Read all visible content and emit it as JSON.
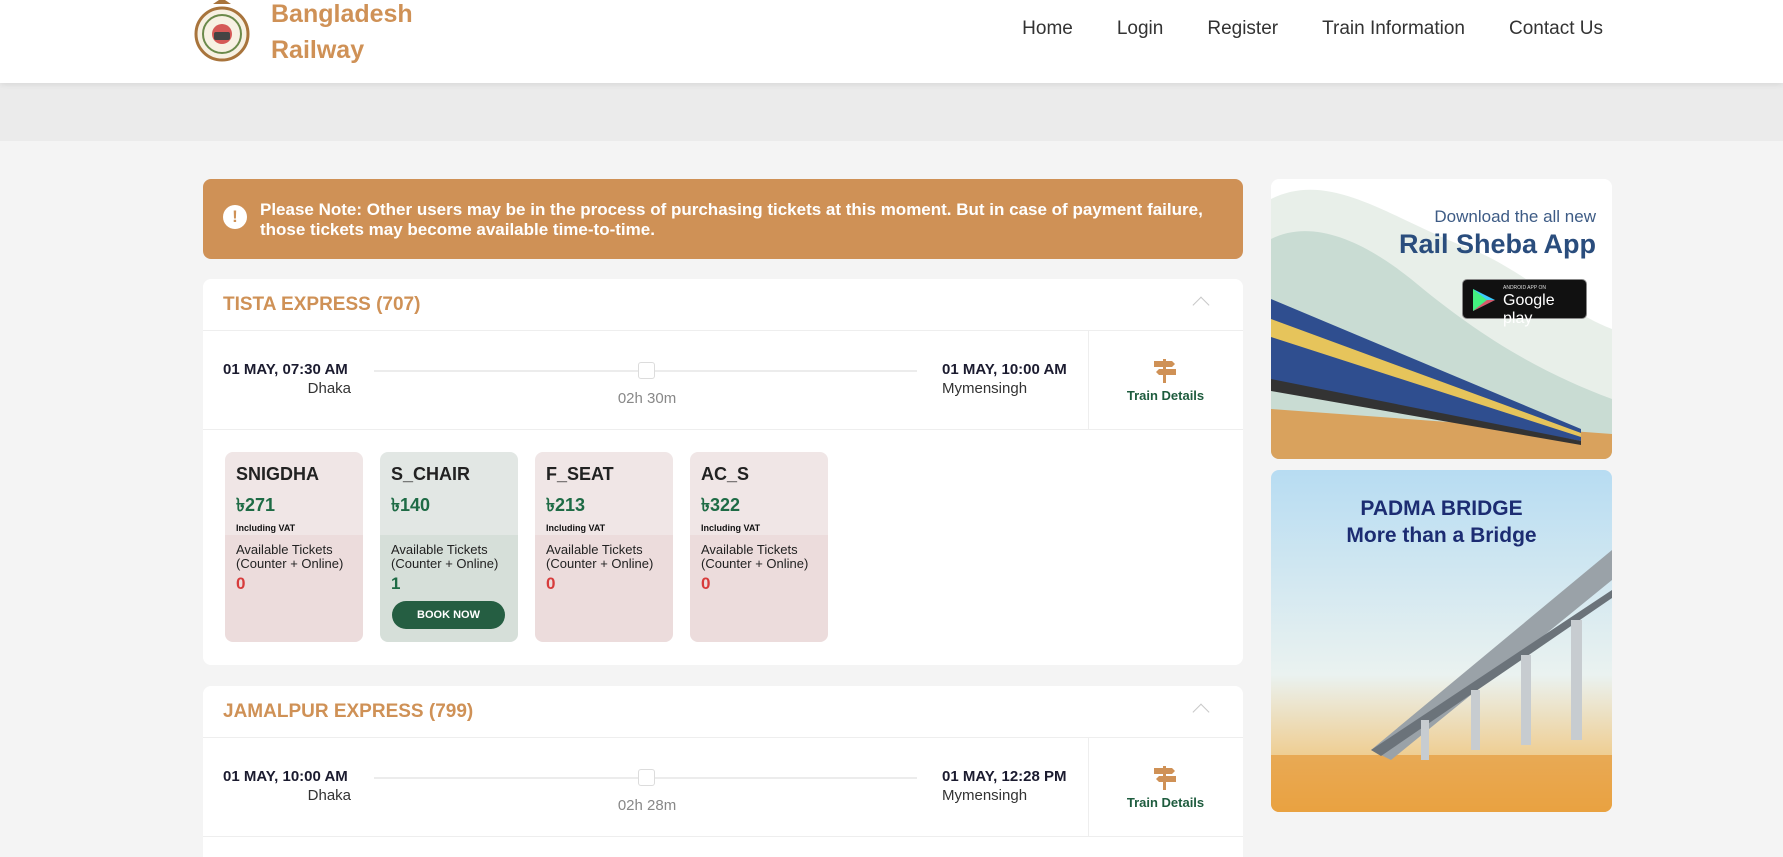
{
  "header": {
    "brand_line1": "Bangladesh",
    "brand_line2": "Railway",
    "nav": [
      "Home",
      "Login",
      "Register",
      "Train Information",
      "Contact Us"
    ]
  },
  "notice": {
    "text": "Please Note: Other users may be in the process of purchasing tickets at this moment. But in case of payment failure, those tickets may become available time-to-time."
  },
  "trains": [
    {
      "name": "TISTA EXPRESS (707)",
      "departure_time": "01 MAY, 07:30 AM",
      "departure_station": "Dhaka",
      "arrival_time": "01 MAY, 10:00 AM",
      "arrival_station": "Mymensingh",
      "duration": "02h 30m",
      "details_label": "Train Details",
      "seats": [
        {
          "class": "SNIGDHA",
          "fare": "৳271",
          "vat": "Including VAT",
          "avail_label": "Available Tickets (Counter + Online)",
          "count": "0"
        },
        {
          "class": "S_CHAIR",
          "fare": "৳140",
          "vat": "",
          "avail_label": "Available Tickets (Counter + Online)",
          "count": "1",
          "button": "BOOK NOW"
        },
        {
          "class": "F_SEAT",
          "fare": "৳213",
          "vat": "Including VAT",
          "avail_label": "Available Tickets (Counter + Online)",
          "count": "0"
        },
        {
          "class": "AC_S",
          "fare": "৳322",
          "vat": "Including VAT",
          "avail_label": "Available Tickets (Counter + Online)",
          "count": "0"
        }
      ]
    },
    {
      "name": "JAMALPUR EXPRESS (799)",
      "departure_time": "01 MAY, 10:00 AM",
      "departure_station": "Dhaka",
      "arrival_time": "01 MAY, 12:28 PM",
      "arrival_station": "Mymensingh",
      "duration": "02h 28m",
      "details_label": "Train Details"
    }
  ],
  "ads": {
    "app_line1": "Download the all new",
    "app_line2": "Rail Sheba App",
    "store_small": "ANDROID APP ON",
    "store_name": "Google play",
    "bridge_line1": "PADMA BRIDGE",
    "bridge_line2": "More than a Bridge"
  },
  "colors": {
    "brand": "#cf9156",
    "accent_green": "#1e6b45",
    "unavailable_red": "#d73c3c"
  }
}
